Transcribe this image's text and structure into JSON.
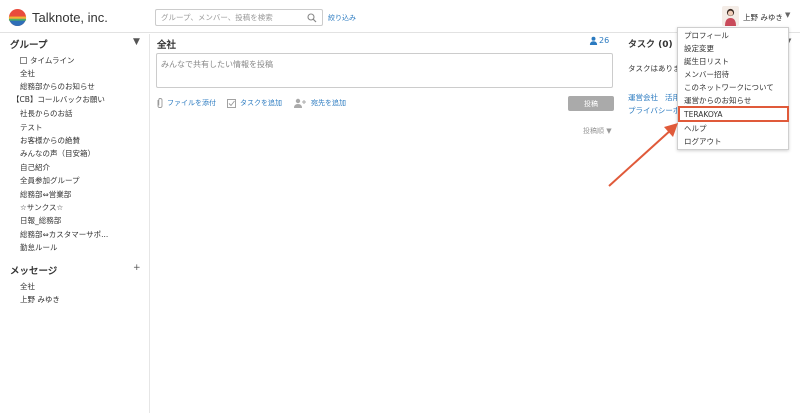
{
  "app": {
    "logo_text": "Talknote, inc."
  },
  "header": {
    "search_placeholder": "グループ、メンバー、投稿を検索",
    "filter_label": "絞り込み",
    "user_name": "上野 みゆき",
    "user_caret": "▼"
  },
  "sidebar": {
    "groups_title": "グループ",
    "groups_toggle": "▼",
    "groups": [
      "タイムライン",
      "全社",
      "総務部からのお知らせ",
      "【CB】コールバックお願い",
      "社長からのお話",
      "テスト",
      "お客様からの絶賛",
      "みんなの声（目安箱）",
      "自己紹介",
      "全員参加グループ",
      "総務部⇔営業部",
      "☆サンクス☆",
      "日報_総務部",
      "総務部⇔カスタマーサポ...",
      "勤怠ルール"
    ],
    "messages_title": "メッセージ",
    "messages_add": "+",
    "messages": [
      "全社",
      "上野 みゆき"
    ]
  },
  "main": {
    "title": "全社",
    "member_count": "26",
    "post_placeholder": "みんなで共有したい情報を投稿",
    "attach_label": "ファイルを添付",
    "task_label": "タスクを追加",
    "recipient_label": "宛先を追加",
    "post_button": "投稿",
    "sort_label": "投稿順 ▼"
  },
  "right": {
    "task_title": "タスク (0)",
    "task_empty": "タスクはありま",
    "caret": "▼",
    "link1": "運営会社",
    "link2": "活用",
    "link3": "プライバシーポ"
  },
  "menu": {
    "items": [
      "プロフィール",
      "設定変更",
      "誕生日リスト",
      "メンバー招待",
      "このネットワークについて",
      "運営からのお知らせ",
      "TERAKOYA",
      "ヘルプ",
      "ログアウト"
    ],
    "highlight_color": "#e05a3a"
  },
  "colors": {
    "link": "#2a7ac0",
    "post_button": "#aaaaaa",
    "annotation": "#e05a3a"
  }
}
